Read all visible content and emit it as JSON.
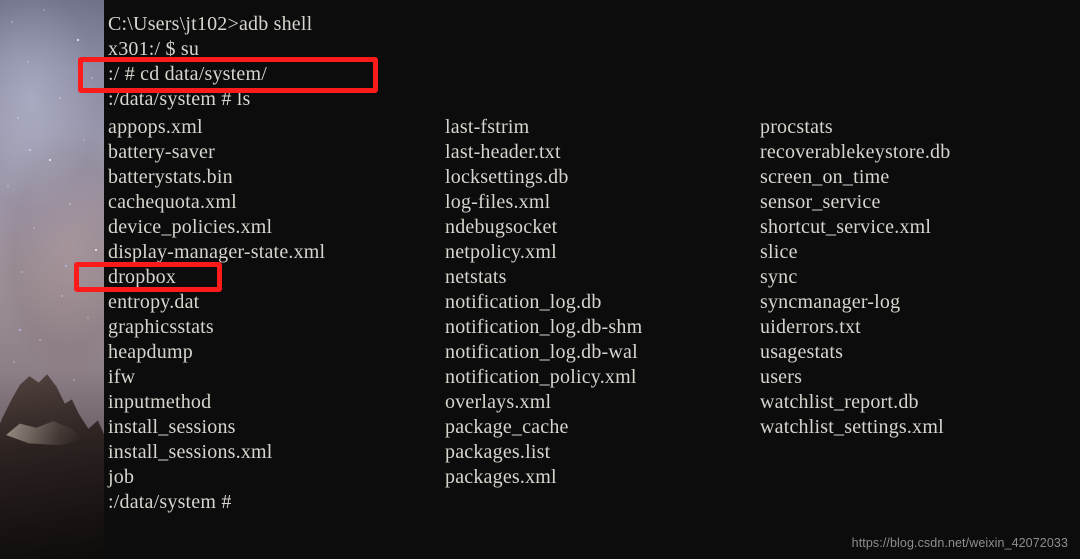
{
  "window": {
    "title": "adb shell - data/system listing",
    "terminal_bg": "#0c0c0c",
    "terminal_fg": "#d8d5ce",
    "highlight_color": "#fb1b1b"
  },
  "wallpaper": {
    "description": "milky-way-night-sky-mountain-wallpaper"
  },
  "terminal": {
    "header_lines": [
      "C:\\Users\\jt102>adb shell",
      "x301:/ $ su",
      ":/ # cd data/system/",
      ":/data/system # ls"
    ],
    "prompt_line": ":/data/system #",
    "columns": [
      [
        "appops.xml",
        "battery-saver",
        "batterystats.bin",
        "cachequota.xml",
        "device_policies.xml",
        "display-manager-state.xml",
        "dropbox",
        "entropy.dat",
        "graphicsstats",
        "heapdump",
        "ifw",
        "inputmethod",
        "install_sessions",
        "install_sessions.xml",
        "job"
      ],
      [
        "last-fstrim",
        "last-header.txt",
        "locksettings.db",
        "log-files.xml",
        "ndebugsocket",
        "netpolicy.xml",
        "netstats",
        "notification_log.db",
        "notification_log.db-shm",
        "notification_log.db-wal",
        "notification_policy.xml",
        "overlays.xml",
        "package_cache",
        "packages.list",
        "packages.xml"
      ],
      [
        "procstats",
        "recoverablekeystore.db",
        "screen_on_time",
        "sensor_service",
        "shortcut_service.xml",
        "slice",
        "sync",
        "syncmanager-log",
        "uiderrors.txt",
        "usagestats",
        "users",
        "watchlist_report.db",
        "watchlist_settings.xml"
      ]
    ]
  },
  "annotations": [
    {
      "id": "hl-cd",
      "label": "cd-command-highlight",
      "target": ":/ # cd data/system/"
    },
    {
      "id": "hl-drop",
      "label": "dropbox-entry-highlight",
      "target": "dropbox"
    }
  ],
  "watermark": {
    "text": "https://blog.csdn.net/weixin_42072033"
  }
}
